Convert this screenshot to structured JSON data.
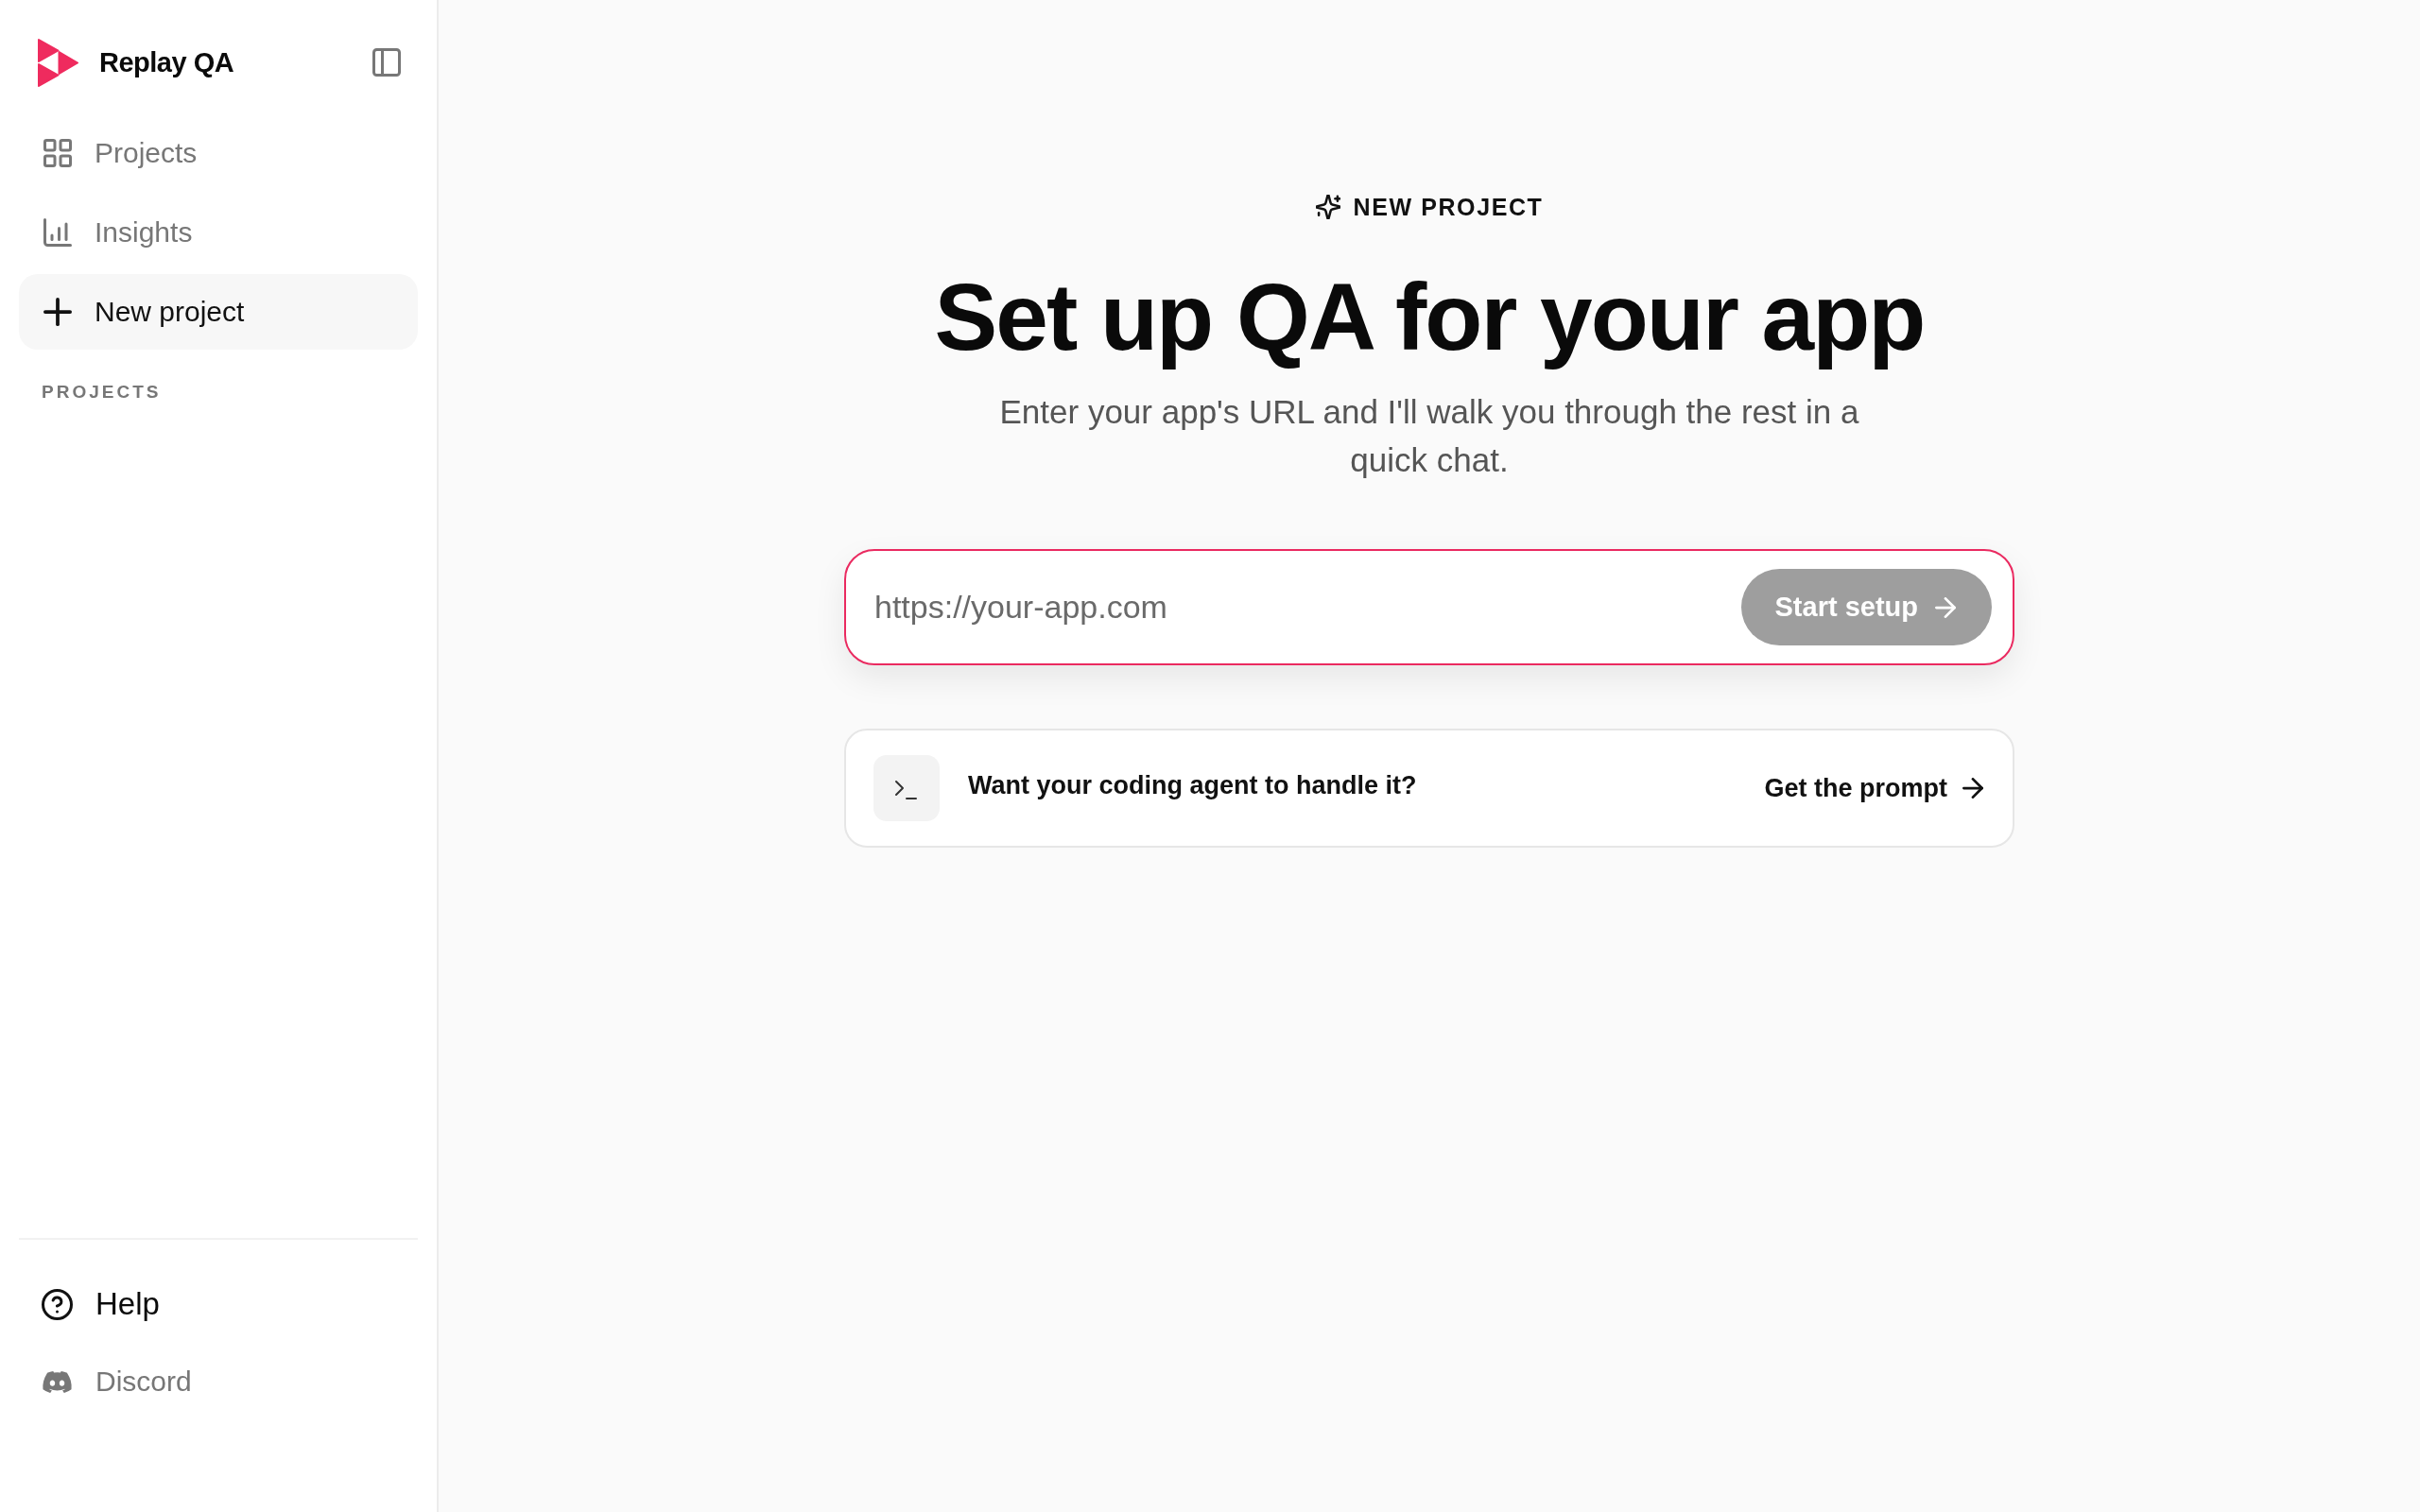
{
  "sidebar": {
    "brand": {
      "name": "Replay QA"
    },
    "nav": [
      {
        "label": "Projects",
        "kind": "grid",
        "selected": false
      },
      {
        "label": "Insights",
        "kind": "chart",
        "selected": false
      },
      {
        "label": "New project",
        "kind": "plus",
        "selected": true
      }
    ],
    "section_label": "PROJECTS",
    "footer": [
      {
        "label": "Help",
        "kind": "help",
        "hovered": true
      },
      {
        "label": "Discord",
        "kind": "discord",
        "hovered": false
      }
    ]
  },
  "main": {
    "eyebrow": "NEW PROJECT",
    "title": "Set up QA for your app",
    "subtitle": "Enter your app's URL and I'll walk you through the rest in a quick chat.",
    "url_field": {
      "placeholder": "https://your-app.com",
      "focused": true
    },
    "start_button": {
      "label": "Start setup",
      "disabled": true
    },
    "agent_card": {
      "text": "Want your coding agent to handle it?",
      "link": "Get the prompt"
    }
  }
}
